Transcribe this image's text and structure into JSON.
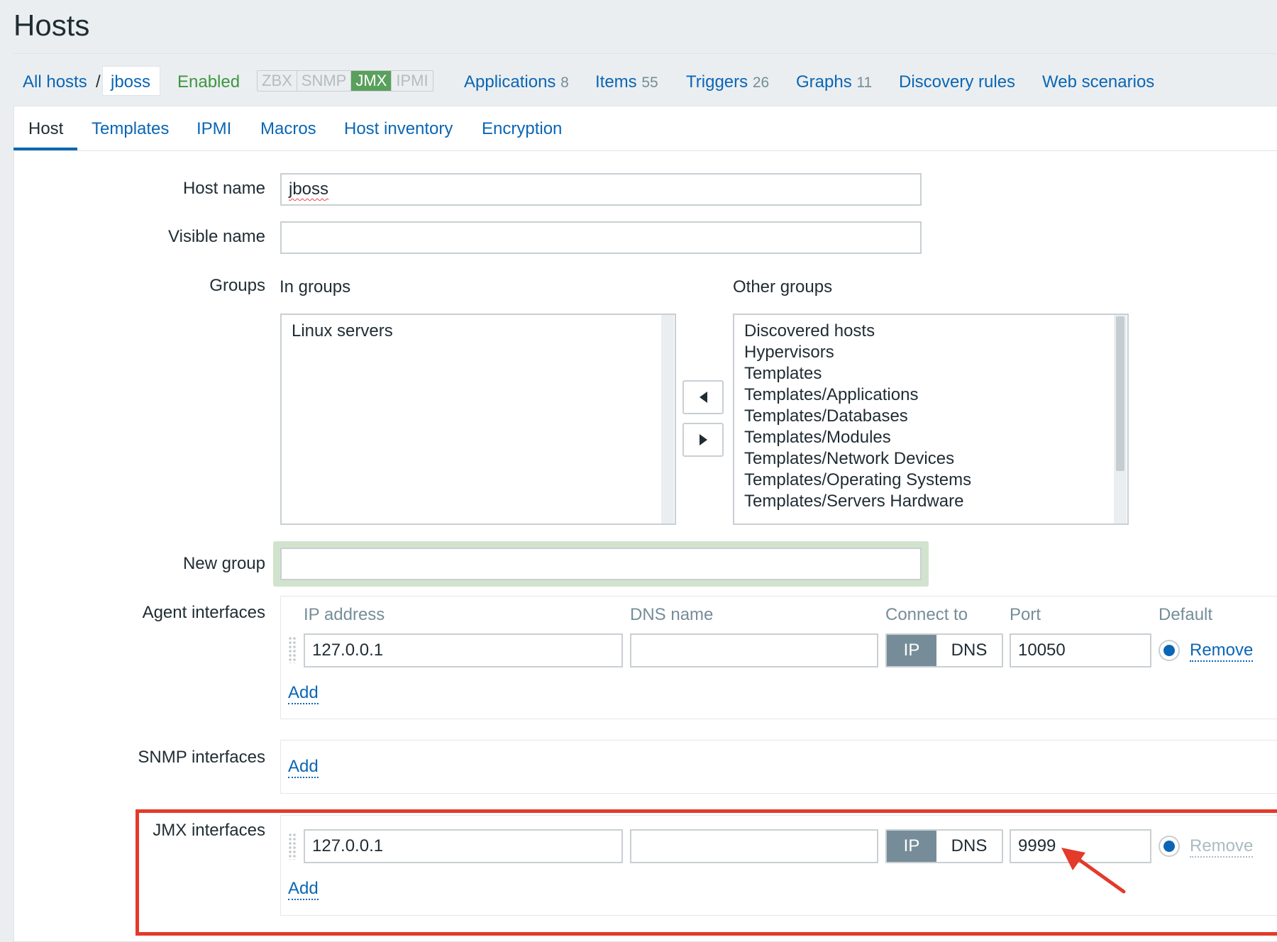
{
  "page": {
    "title": "Hosts"
  },
  "nav": {
    "breadcrumb_all": "All hosts",
    "separator": "/",
    "breadcrumb_current": "jboss",
    "status": "Enabled",
    "availability": [
      "ZBX",
      "SNMP",
      "JMX",
      "IPMI"
    ],
    "links": [
      {
        "label": "Applications",
        "count": "8"
      },
      {
        "label": "Items",
        "count": "55"
      },
      {
        "label": "Triggers",
        "count": "26"
      },
      {
        "label": "Graphs",
        "count": "11"
      },
      {
        "label": "Discovery rules",
        "count": ""
      },
      {
        "label": "Web scenarios",
        "count": ""
      }
    ]
  },
  "tabs": [
    "Host",
    "Templates",
    "IPMI",
    "Macros",
    "Host inventory",
    "Encryption"
  ],
  "form": {
    "host_name_label": "Host name",
    "host_name_value": "jboss",
    "visible_name_label": "Visible name",
    "visible_name_value": "",
    "groups_label": "Groups",
    "in_groups_label": "In groups",
    "other_groups_label": "Other groups",
    "in_groups": [
      "Linux servers"
    ],
    "other_groups": [
      "Discovered hosts",
      "Hypervisors",
      "Templates",
      "Templates/Applications",
      "Templates/Databases",
      "Templates/Modules",
      "Templates/Network Devices",
      "Templates/Operating Systems",
      "Templates/Servers Hardware"
    ],
    "new_group_label": "New group",
    "new_group_value": ""
  },
  "interfaces": {
    "columns": {
      "ip": "IP address",
      "dns": "DNS name",
      "connect": "Connect to",
      "port": "Port",
      "default": "Default"
    },
    "connect_ip": "IP",
    "connect_dns": "DNS",
    "remove": "Remove",
    "add": "Add",
    "agent": {
      "label": "Agent interfaces",
      "ip": "127.0.0.1",
      "dns": "",
      "port": "10050"
    },
    "snmp": {
      "label": "SNMP interfaces"
    },
    "jmx": {
      "label": "JMX interfaces",
      "ip": "127.0.0.1",
      "dns": "",
      "port": "9999"
    }
  },
  "colors": {
    "link": "#0a66b5",
    "enabled": "#3d9641",
    "jmx_on": "#59a05c",
    "highlight": "#e33a2a",
    "connect_selected": "#768d99"
  }
}
